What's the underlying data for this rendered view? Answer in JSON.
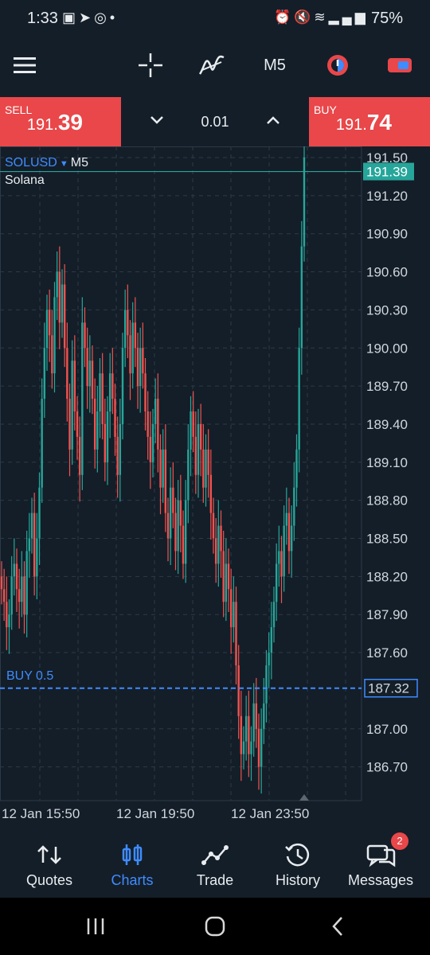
{
  "status_bar": {
    "time": "1:33",
    "battery": "75%",
    "left_icons": [
      "image-icon",
      "telegram-icon",
      "instagram-icon",
      "dot-icon"
    ],
    "right_icons": [
      "alarm-icon",
      "mute-icon",
      "wifi-icon",
      "signal-icon",
      "signal-icon",
      "battery-icon"
    ]
  },
  "toolbar": {
    "timeframe": "M5",
    "icons": [
      "menu-icon",
      "crosshair-icon",
      "indicators-icon",
      "timeframe-label",
      "one-click-trading-icon",
      "trade-panel-icon"
    ]
  },
  "trade_panel": {
    "sell_label": "SELL",
    "sell_price_prefix": "191.",
    "sell_price_big": "39",
    "buy_label": "BUY",
    "buy_price_prefix": "191.",
    "buy_price_big": "74",
    "volume": "0.01"
  },
  "chart": {
    "symbol": "SOLUSD",
    "timeframe": "M5",
    "description": "Solana",
    "current_price_tag": "191.39",
    "position_label": "BUY 0.5",
    "position_price_tag": "187.32",
    "colors": {
      "bull": "#26a69a",
      "bear": "#ef5350",
      "position_line": "#3f8cff",
      "current_line": "#26a69a",
      "background": "#141e28"
    }
  },
  "chart_data": {
    "type": "candlestick",
    "title": "SOLUSD, M5",
    "ylim": [
      186.4,
      191.6
    ],
    "y_ticks": [
      "191.50",
      "191.20",
      "190.90",
      "190.60",
      "190.30",
      "190.00",
      "189.70",
      "189.40",
      "189.10",
      "188.80",
      "188.50",
      "188.20",
      "187.90",
      "187.60",
      "187.00",
      "186.70"
    ],
    "x_ticks": [
      "12 Jan 15:50",
      "12 Jan 19:50",
      "12 Jan 23:50"
    ],
    "series": [
      {
        "name": "SOLUSD",
        "close": [
          188.1,
          188.0,
          187.8,
          187.9,
          188.2,
          188.3,
          188.1,
          188.0,
          188.2,
          187.9,
          188.4,
          188.5,
          188.7,
          188.2,
          188.5,
          188.9,
          189.6,
          190.0,
          190.3,
          190.1,
          189.8,
          190.4,
          190.6,
          190.2,
          190.5,
          190.0,
          189.6,
          189.2,
          189.9,
          189.5,
          189.3,
          189.0,
          190.2,
          190.0,
          189.7,
          189.9,
          189.6,
          189.2,
          189.5,
          189.8,
          189.4,
          189.1,
          189.5,
          189.8,
          189.6,
          189.3,
          189.0,
          189.4,
          190.0,
          190.3,
          190.1,
          189.8,
          190.2,
          190.0,
          189.7,
          190.0,
          189.8,
          189.5,
          189.3,
          189.1,
          189.4,
          189.6,
          189.2,
          188.9,
          189.2,
          188.7,
          188.5,
          188.9,
          188.7,
          188.4,
          188.8,
          188.6,
          188.3,
          188.8,
          189.2,
          189.5,
          189.3,
          189.0,
          189.4,
          189.2,
          188.9,
          189.2,
          189.0,
          188.7,
          188.5,
          188.3,
          188.6,
          188.4,
          188.0,
          188.3,
          188.1,
          187.8,
          188.0,
          187.5,
          187.1,
          186.8,
          186.9,
          187.1,
          186.8,
          186.9,
          187.2,
          187.0,
          186.7,
          187.0,
          187.2,
          187.5,
          187.6,
          187.8,
          188.0,
          188.3,
          188.4,
          188.2,
          188.6,
          188.7,
          188.4,
          188.6,
          188.9,
          189.2,
          190.0,
          190.8,
          191.5
        ]
      }
    ],
    "grid": true,
    "legend": "none"
  },
  "nav": {
    "items": [
      {
        "label": "Quotes",
        "icon": "quotes-icon",
        "active": false
      },
      {
        "label": "Charts",
        "icon": "charts-icon",
        "active": true
      },
      {
        "label": "Trade",
        "icon": "trade-icon",
        "active": false
      },
      {
        "label": "History",
        "icon": "history-icon",
        "active": false
      },
      {
        "label": "Messages",
        "icon": "messages-icon",
        "active": false,
        "badge": "2"
      }
    ]
  },
  "system_nav": [
    "recents-icon",
    "home-icon",
    "back-icon"
  ]
}
